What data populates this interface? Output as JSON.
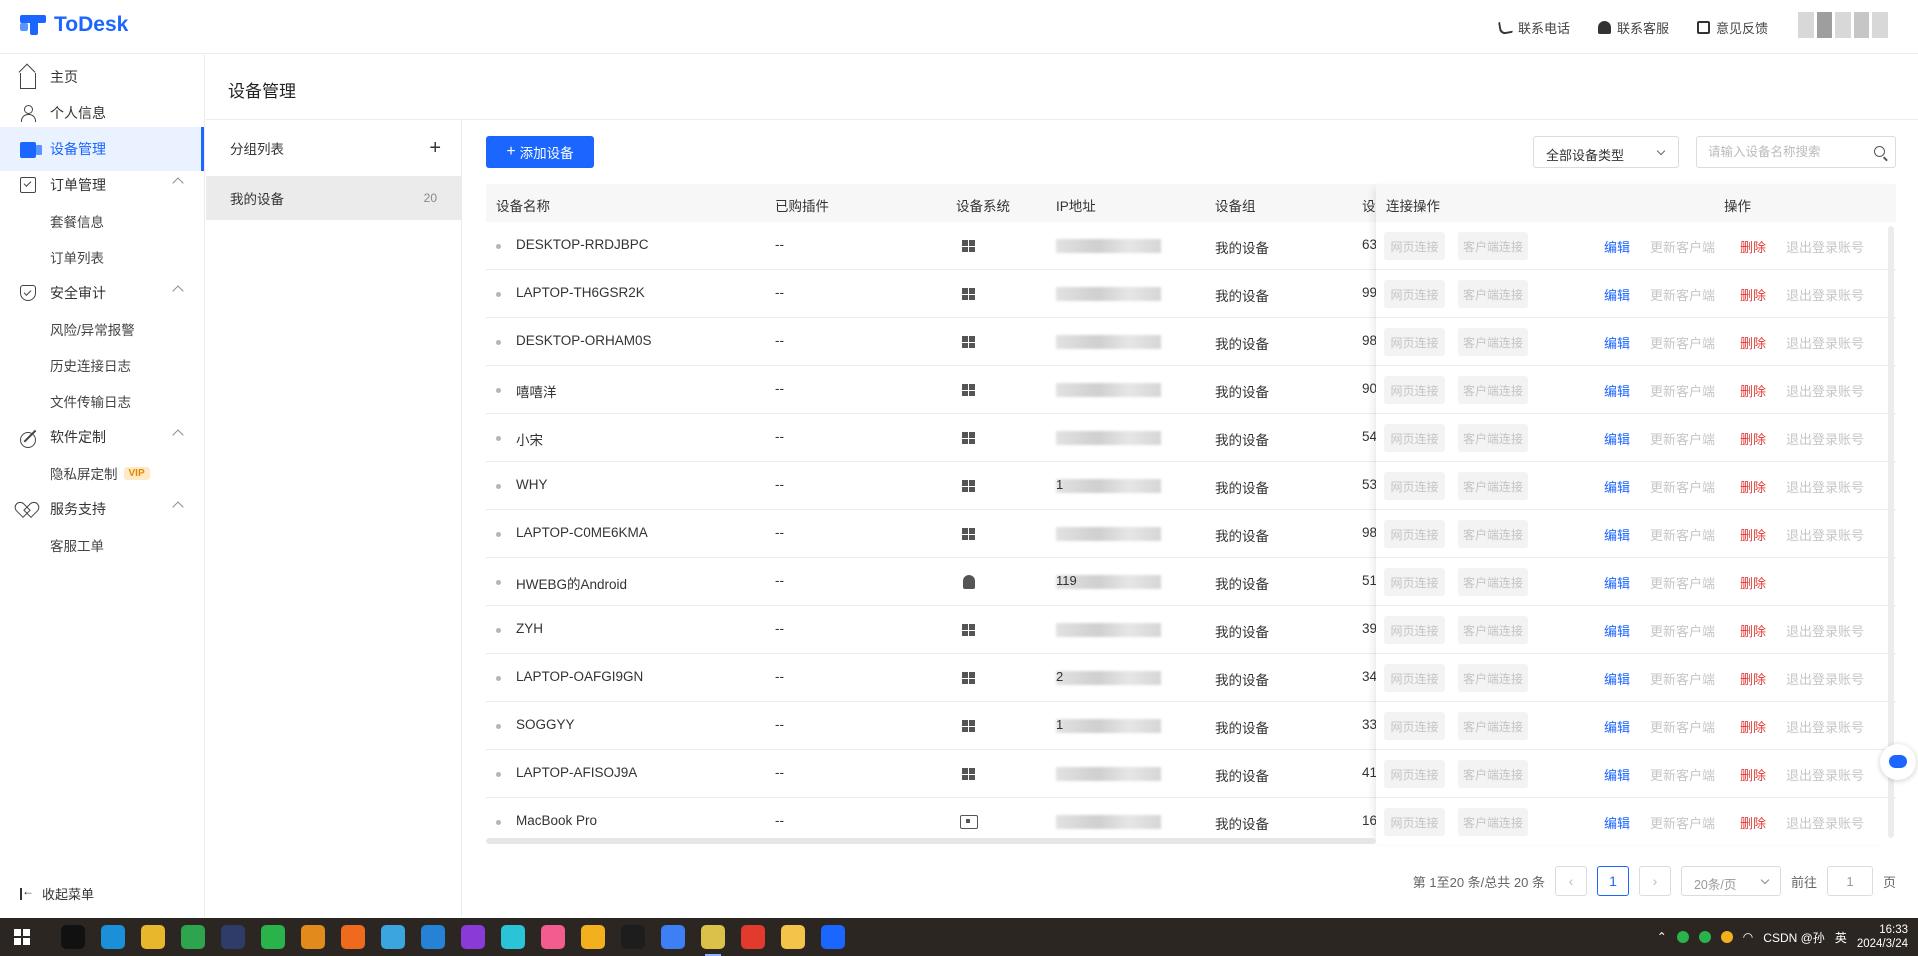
{
  "app": {
    "name": "ToDesk"
  },
  "top_actions": [
    {
      "label": "联系电话",
      "icon": "phone-icon"
    },
    {
      "label": "联系客服",
      "icon": "customer-service-icon"
    },
    {
      "label": "意见反馈",
      "icon": "feedback-icon"
    }
  ],
  "sidebar": {
    "items": [
      {
        "label": "主页",
        "icon": "home-icon"
      },
      {
        "label": "个人信息",
        "icon": "user-icon"
      },
      {
        "label": "设备管理",
        "icon": "device-icon",
        "active": true
      },
      {
        "label": "订单管理",
        "icon": "order-icon",
        "expanded": true,
        "children": [
          "套餐信息",
          "订单列表"
        ]
      },
      {
        "label": "安全审计",
        "icon": "shield-icon",
        "expanded": true,
        "children": [
          "风险/异常报警",
          "历史连接日志",
          "文件传输日志"
        ]
      },
      {
        "label": "软件定制",
        "icon": "tools-icon",
        "expanded": true,
        "children": [
          "隐私屏定制"
        ]
      },
      {
        "label": "服务支持",
        "icon": "support-icon",
        "expanded": true,
        "children": [
          "客服工单"
        ]
      }
    ],
    "vip_badge": "VIP",
    "collapse_label": "收起菜单"
  },
  "page": {
    "title": "设备管理"
  },
  "groups": {
    "header": "分组列表",
    "items": [
      {
        "name": "我的设备",
        "count": "20"
      }
    ]
  },
  "toolbar": {
    "add_label": "添加设备",
    "device_type": "全部设备类型",
    "search_placeholder": "请输入设备名称搜索"
  },
  "table": {
    "columns": [
      "设备名称",
      "已购插件",
      "设备系统",
      "IP地址",
      "设备组",
      "设",
      "连接操作",
      "操作"
    ],
    "connect_buttons": [
      "网页连接",
      "客户端连接"
    ],
    "actions": {
      "edit": "编辑",
      "update": "更新客户端",
      "delete": "删除",
      "logout": "退出登录账号"
    },
    "rows": [
      {
        "name": "DESKTOP-RRDJBPC",
        "plugin": "--",
        "os": "windows",
        "ip_prefix": "",
        "group": "我的设备",
        "extra": "63",
        "logout": true
      },
      {
        "name": "LAPTOP-TH6GSR2K",
        "plugin": "--",
        "os": "windows",
        "ip_prefix": "",
        "group": "我的设备",
        "extra": "99",
        "logout": true
      },
      {
        "name": "DESKTOP-ORHAM0S",
        "plugin": "--",
        "os": "windows",
        "ip_prefix": "",
        "group": "我的设备",
        "extra": "98",
        "logout": true
      },
      {
        "name": "嘻嘻洋",
        "plugin": "--",
        "os": "windows",
        "ip_prefix": "",
        "group": "我的设备",
        "extra": "90",
        "logout": true
      },
      {
        "name": "小宋",
        "plugin": "--",
        "os": "windows",
        "ip_prefix": "",
        "group": "我的设备",
        "extra": "54",
        "logout": true
      },
      {
        "name": "WHY",
        "plugin": "--",
        "os": "windows",
        "ip_prefix": "1",
        "group": "我的设备",
        "extra": "53",
        "logout": true
      },
      {
        "name": "LAPTOP-C0ME6KMA",
        "plugin": "--",
        "os": "windows",
        "ip_prefix": "",
        "group": "我的设备",
        "extra": "98",
        "logout": true
      },
      {
        "name": "HWEBG的Android",
        "plugin": "--",
        "os": "android",
        "ip_prefix": "119",
        "group": "我的设备",
        "extra": "51",
        "logout": false
      },
      {
        "name": "ZYH",
        "plugin": "--",
        "os": "windows",
        "ip_prefix": "",
        "group": "我的设备",
        "extra": "39",
        "logout": true
      },
      {
        "name": "LAPTOP-OAFGI9GN",
        "plugin": "--",
        "os": "windows",
        "ip_prefix": "2",
        "group": "我的设备",
        "extra": "34",
        "logout": true
      },
      {
        "name": "SOGGYY",
        "plugin": "--",
        "os": "windows",
        "ip_prefix": "1",
        "group": "我的设备",
        "extra": "33",
        "logout": true
      },
      {
        "name": "LAPTOP-AFISOJ9A",
        "plugin": "--",
        "os": "windows",
        "ip_prefix": "",
        "group": "我的设备",
        "extra": "41",
        "logout": true
      },
      {
        "name": "MacBook Pro",
        "plugin": "--",
        "os": "mac",
        "ip_prefix": "",
        "group": "我的设备",
        "extra": "16",
        "logout": true
      }
    ]
  },
  "pagination": {
    "summary": "第 1至20 条/总共 20 条",
    "current": "1",
    "page_size": "20条/页",
    "goto_label": "前往",
    "goto_value": "1",
    "page_suffix": "页"
  },
  "taskbar": {
    "apps": [
      {
        "name": "idea-app",
        "color": "#111111"
      },
      {
        "name": "edge-app",
        "color": "#1b8fd8"
      },
      {
        "name": "chrome-app",
        "color": "#e8b72b"
      },
      {
        "name": "pycharm-app",
        "color": "#2ea44f"
      },
      {
        "name": "app-dark",
        "color": "#2f3b68"
      },
      {
        "name": "wechat-app",
        "color": "#29b34a"
      },
      {
        "name": "orange-app",
        "color": "#e38a1c"
      },
      {
        "name": "firefox-app",
        "color": "#f06a1d"
      },
      {
        "name": "bilibili-app",
        "color": "#3ba5e0"
      },
      {
        "name": "vscode-app",
        "color": "#2582d4"
      },
      {
        "name": "datagrip-app",
        "color": "#8a3ad6"
      },
      {
        "name": "search-app",
        "color": "#2ac3d8"
      },
      {
        "name": "pink-app",
        "color": "#f25c8f"
      },
      {
        "name": "colorful-app",
        "color": "#f2b01e"
      },
      {
        "name": "github-app",
        "color": "#1d1d1d"
      },
      {
        "name": "feishu-app",
        "color": "#3f7ff5"
      },
      {
        "name": "chrome-active-app",
        "color": "#d9c14a"
      },
      {
        "name": "red-app",
        "color": "#e23b2e"
      },
      {
        "name": "explorer-app",
        "color": "#f3c34a"
      },
      {
        "name": "todesk-app",
        "color": "#1a66ff"
      }
    ],
    "tray_text": "CSDN @孙",
    "lang": "英",
    "time": "16:33",
    "date": "2024/3/24"
  }
}
